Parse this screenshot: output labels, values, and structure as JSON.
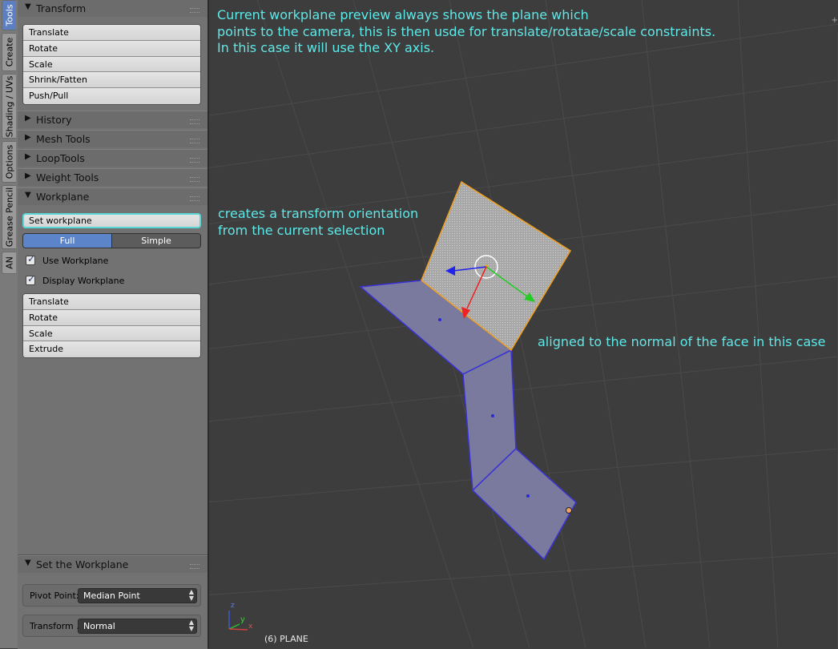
{
  "tabs": [
    {
      "label": "Tools",
      "active": true
    },
    {
      "label": "Create",
      "active": false
    },
    {
      "label": "Shading / UVs",
      "active": false
    },
    {
      "label": "Options",
      "active": false
    },
    {
      "label": "Grease Pencil",
      "active": false
    },
    {
      "label": "AN",
      "active": false
    }
  ],
  "transform": {
    "title": "Transform",
    "buttons": [
      "Translate",
      "Rotate",
      "Scale",
      "Shrink/Fatten",
      "Push/Pull"
    ]
  },
  "panels": {
    "history": "History",
    "mesh_tools": "Mesh Tools",
    "loop_tools": "LoopTools",
    "weight_tools": "Weight Tools",
    "workplane": "Workplane"
  },
  "workplane": {
    "set_button": "Set workplane",
    "mode_full": "Full",
    "mode_simple": "Simple",
    "active_mode": "Full",
    "use_workplane": {
      "label": "Use Workplane",
      "checked": true
    },
    "display_workplane": {
      "label": "Display Workplane",
      "checked": true
    },
    "buttons": [
      "Translate",
      "Rotate",
      "Scale",
      "Extrude"
    ]
  },
  "operator_panel": {
    "title": "Set the Workplane",
    "pivot_point": {
      "label": "Pivot Point:",
      "value": "Median Point"
    },
    "transform_orientation": {
      "label": "Transform ...",
      "value": "Normal"
    }
  },
  "viewport": {
    "annotation_top": "Current workplane preview always shows the plane which\npoints to the camera, this is then usde for translate/rotatae/scale constraints.\nIn this case it will use the XY axis.",
    "annotation_mid": "creates a transform orientation\nfrom the current selection",
    "annotation_right": "aligned to the normal of the face in this case",
    "status": "(6) PLANE",
    "axis_z": "z",
    "axis_y": "y",
    "axis_x": "x"
  },
  "colors": {
    "annotation": "#5ee8e8",
    "selected_face_edge": "#f0a020",
    "mesh_edge": "#3a32d6",
    "mesh_face": "#7a7a9e",
    "active_tab": "#5c7fc2"
  }
}
